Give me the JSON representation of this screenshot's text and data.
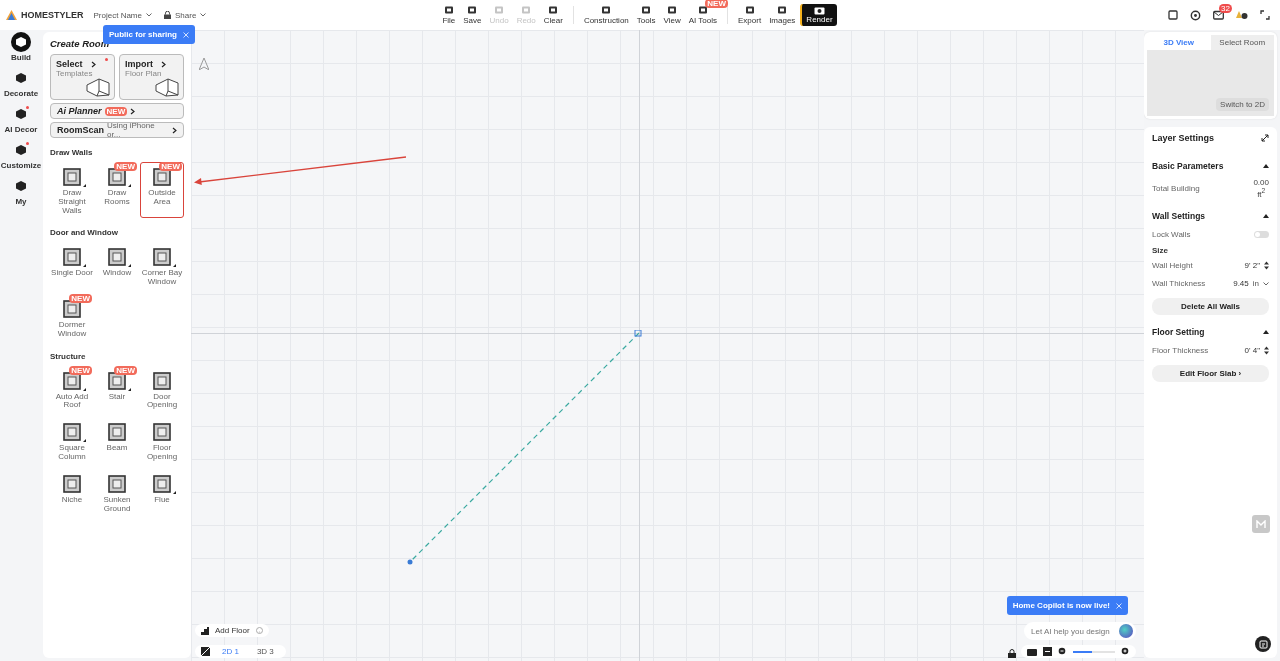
{
  "top_bar": {
    "logo": "HOMESTYLER",
    "project_name": "Project Name",
    "share": "Share",
    "share_tooltip": "Public for sharing",
    "notification_count": "32",
    "tools": [
      {
        "label": "File",
        "disabled": false,
        "kind": "tool"
      },
      {
        "label": "Save",
        "disabled": false,
        "kind": "tool"
      },
      {
        "label": "Undo",
        "disabled": true,
        "kind": "tool"
      },
      {
        "label": "Redo",
        "disabled": true,
        "kind": "tool"
      },
      {
        "label": "Clear",
        "disabled": false,
        "kind": "tool"
      },
      {
        "label": "Construction",
        "disabled": false,
        "kind": "tool"
      },
      {
        "label": "Tools",
        "disabled": false,
        "kind": "tool"
      },
      {
        "label": "View",
        "disabled": false,
        "kind": "tool"
      },
      {
        "label": "AI Tools",
        "disabled": false,
        "kind": "tool",
        "badge": "NEW"
      },
      {
        "label": "Export",
        "disabled": false,
        "kind": "tool"
      },
      {
        "label": "Images",
        "disabled": false,
        "kind": "tool"
      },
      {
        "label": "Render",
        "kind": "render"
      }
    ]
  },
  "rail": [
    {
      "label": "Build",
      "selected": true,
      "dot": false
    },
    {
      "label": "Decorate",
      "selected": false,
      "dot": false
    },
    {
      "label": "AI Decor",
      "selected": false,
      "dot": true
    },
    {
      "label": "Customize",
      "selected": false,
      "dot": true
    },
    {
      "label": "My",
      "selected": false,
      "dot": false
    }
  ],
  "create_room": {
    "title": "Create Room",
    "cards": [
      {
        "title": "Select",
        "subtitle": "Templates",
        "dot": true
      },
      {
        "title": "Import",
        "subtitle": "Floor Plan",
        "dot": false
      }
    ],
    "ai_planner": {
      "label": "Ai Planner",
      "badge": "NEW"
    },
    "roomscan": {
      "label": "RoomScan",
      "hint": "Using iPhone or..."
    },
    "sections": [
      {
        "title": "Draw Walls",
        "items": [
          {
            "label": "Draw Straight Walls",
            "menu": true,
            "highlighted": false
          },
          {
            "label": "Draw Rooms",
            "badge": "NEW",
            "menu": true,
            "highlighted": false
          },
          {
            "label": "Outside Area",
            "badge": "NEW",
            "menu": false,
            "highlighted": true
          }
        ]
      },
      {
        "title": "Door and Window",
        "items": [
          {
            "label": "Single Door",
            "menu": true,
            "highlighted": false
          },
          {
            "label": "Window",
            "menu": true,
            "highlighted": false
          },
          {
            "label": "Corner Bay Window",
            "menu": true,
            "highlighted": false
          },
          {
            "label": "Dormer Window",
            "badge": "NEW",
            "menu": false,
            "highlighted": false
          }
        ]
      },
      {
        "title": "Structure",
        "items": [
          {
            "label": "Auto Add Roof",
            "badge": "NEW",
            "menu": true,
            "highlighted": false
          },
          {
            "label": "Stair",
            "badge": "NEW",
            "menu": true,
            "highlighted": false
          },
          {
            "label": "Door Opening",
            "menu": false,
            "highlighted": false
          },
          {
            "label": "Square Column",
            "menu": true,
            "highlighted": false
          },
          {
            "label": "Beam",
            "menu": false,
            "highlighted": false
          },
          {
            "label": "Floor Opening",
            "menu": false,
            "highlighted": false
          },
          {
            "label": "Niche",
            "menu": false,
            "highlighted": false
          },
          {
            "label": "Sunken Ground",
            "menu": false,
            "highlighted": false
          },
          {
            "label": "Flue",
            "menu": true,
            "highlighted": false
          }
        ]
      }
    ]
  },
  "canvas": {
    "add_floor": "Add Floor",
    "floors": [
      {
        "label": "2D 1",
        "selected": true
      },
      {
        "label": "3D 3",
        "selected": false
      }
    ],
    "copilot": {
      "tooltip": "Home Copilot is now live!",
      "placeholder": "Let AI help you design"
    },
    "zoom": {
      "level": 0.45
    }
  },
  "preview": {
    "tabs": [
      {
        "label": "3D View",
        "selected": true
      },
      {
        "label": "Select Room",
        "selected": false
      }
    ],
    "switch": "Switch to 2D"
  },
  "layer_settings": {
    "title": "Layer Settings",
    "sections": [
      {
        "title": "Basic Parameters",
        "expanded": true,
        "rows": [
          {
            "kind": "value",
            "label": "Total Building",
            "value": "0.00",
            "unit": "ft$^{2}$"
          }
        ]
      },
      {
        "title": "Wall Settings",
        "expanded": true,
        "rows": [
          {
            "kind": "toggle",
            "label": "Lock Walls",
            "on": false
          },
          {
            "kind": "heading",
            "label": "Size"
          },
          {
            "kind": "stepper",
            "label": "Wall Height",
            "value": "9' 2\""
          },
          {
            "kind": "select",
            "label": "Wall Thickness",
            "value": "9.45",
            "unit": "in"
          },
          {
            "kind": "button",
            "label": "Delete All Walls"
          }
        ]
      },
      {
        "title": "Floor Setting",
        "expanded": true,
        "rows": [
          {
            "kind": "stepper",
            "label": "Floor Thickness",
            "value": "0' 4\""
          },
          {
            "kind": "button",
            "label": "Edit Floor Slab ›"
          }
        ]
      }
    ]
  }
}
